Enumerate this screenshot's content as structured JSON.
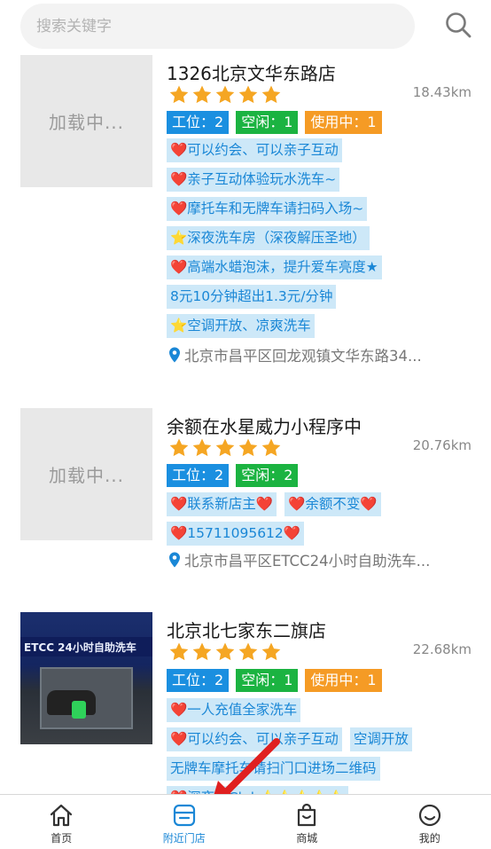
{
  "search": {
    "placeholder": "搜索关键字"
  },
  "stores": [
    {
      "name": "1326北京文华东路店",
      "rating": 5,
      "distance": "18.43km",
      "thumb_text": "加载中...",
      "status": [
        {
          "label": "工位：2",
          "kind": "work"
        },
        {
          "label": "空闲：1",
          "kind": "idle"
        },
        {
          "label": "使用中：1",
          "kind": "busy"
        }
      ],
      "tags": [
        [
          "❤️可以约会、可以亲子互动"
        ],
        [
          "❤️亲子互动体验玩水洗车~"
        ],
        [
          "❤️摩托车和无牌车请扫码入场~"
        ],
        [
          "⭐深夜洗车房（深夜解压圣地）"
        ],
        [
          "❤️高端水蜡泡沫，提升爱车亮度★"
        ],
        [
          "8元10分钟超出1.3元/分钟"
        ],
        [
          "⭐空调开放、凉爽洗车"
        ]
      ],
      "address": "北京市昌平区回龙观镇文华东路34..."
    },
    {
      "name": "余额在水星威力小程序中",
      "rating": 5,
      "distance": "20.76km",
      "thumb_text": "加载中...",
      "status": [
        {
          "label": "工位：2",
          "kind": "work"
        },
        {
          "label": "空闲：2",
          "kind": "idle"
        }
      ],
      "tags": [
        [
          "❤️联系新店主❤️",
          "❤️余额不变❤️"
        ],
        [
          "❤️15711095612❤️"
        ]
      ],
      "address": "北京市昌平区ETCC24小时自助洗车..."
    },
    {
      "name": "北京北七家东二旗店",
      "rating": 5,
      "distance": "22.68km",
      "photo_sign": "ETCC 24小时自助洗车",
      "status": [
        {
          "label": "工位：2",
          "kind": "work"
        },
        {
          "label": "空闲：1",
          "kind": "idle"
        },
        {
          "label": "使用中：1",
          "kind": "busy"
        }
      ],
      "tags": [
        [
          "❤️一人充值全家洗车"
        ],
        [
          "❤️可以约会、可以亲子互动",
          "空调开放"
        ],
        [
          "无牌车摩托车请扫门口进场二维码"
        ],
        [
          "❤️深夜…Club⭐⭐⭐⭐⭐"
        ]
      ]
    }
  ],
  "tabbar": [
    {
      "label": "首页",
      "icon": "home-icon",
      "active": false
    },
    {
      "label": "附近门店",
      "icon": "store-icon",
      "active": true
    },
    {
      "label": "商城",
      "icon": "shopping-bag-icon",
      "active": false
    },
    {
      "label": "我的",
      "icon": "smile-face-icon",
      "active": false
    }
  ],
  "colors": {
    "accent": "#1a87d6",
    "work": "#1a8fe0",
    "idle": "#1bb341",
    "busy": "#f59b25",
    "tag_bg": "#cde8f8",
    "star": "#f5a623",
    "arrow": "#e02020"
  }
}
